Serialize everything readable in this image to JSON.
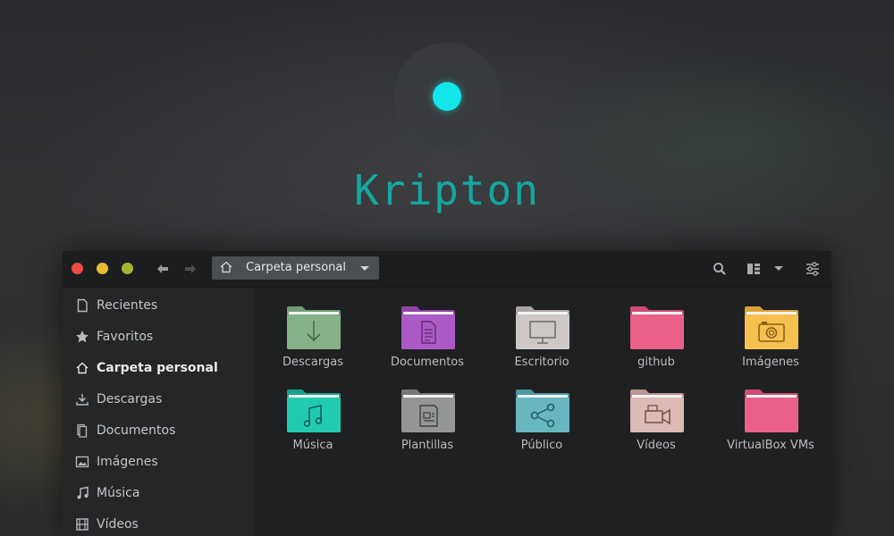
{
  "brand": {
    "name": "Kripton",
    "accent": "#12e6e8",
    "text_color": "#13a8a0"
  },
  "window": {
    "controls": [
      "close",
      "minimize",
      "maximize"
    ],
    "nav": {
      "back_icon": "arrow-left-icon",
      "forward_icon": "arrow-right-icon"
    },
    "path": {
      "icon": "home-icon",
      "label": "Carpeta personal"
    },
    "toolbar": [
      "search-icon",
      "grid-view-icon",
      "chevron-down-icon",
      "settings-sliders-icon"
    ]
  },
  "sidebar": {
    "items": [
      {
        "label": "Recientes",
        "icon": "document-icon",
        "active": false
      },
      {
        "label": "Favoritos",
        "icon": "star-icon",
        "active": false
      },
      {
        "label": "Carpeta personal",
        "icon": "home-icon",
        "active": true
      },
      {
        "label": "Descargas",
        "icon": "download-icon",
        "active": false
      },
      {
        "label": "Documentos",
        "icon": "documents-icon",
        "active": false
      },
      {
        "label": "Imágenes",
        "icon": "image-icon",
        "active": false
      },
      {
        "label": "Música",
        "icon": "music-icon",
        "active": false
      },
      {
        "label": "Vídeos",
        "icon": "film-icon",
        "active": false
      }
    ]
  },
  "files": [
    {
      "label": "Descargas",
      "color": "#7fae84",
      "glyph": "download"
    },
    {
      "label": "Documentos",
      "color": "#a656c0",
      "glyph": "document"
    },
    {
      "label": "Escritorio",
      "color": "#c9c4c2",
      "glyph": "monitor"
    },
    {
      "label": "github",
      "color": "#e85e87",
      "glyph": "none"
    },
    {
      "label": "Imágenes",
      "color": "#f3bd4c",
      "glyph": "camera"
    },
    {
      "label": "Música",
      "color": "#1fc7ab",
      "glyph": "music"
    },
    {
      "label": "Plantillas",
      "color": "#8f9193",
      "glyph": "template"
    },
    {
      "label": "Público",
      "color": "#63b3bd",
      "glyph": "share"
    },
    {
      "label": "Vídeos",
      "color": "#d8b7b2",
      "glyph": "video"
    },
    {
      "label": "VirtualBox VMs",
      "color": "#e85e87",
      "glyph": "none"
    }
  ]
}
